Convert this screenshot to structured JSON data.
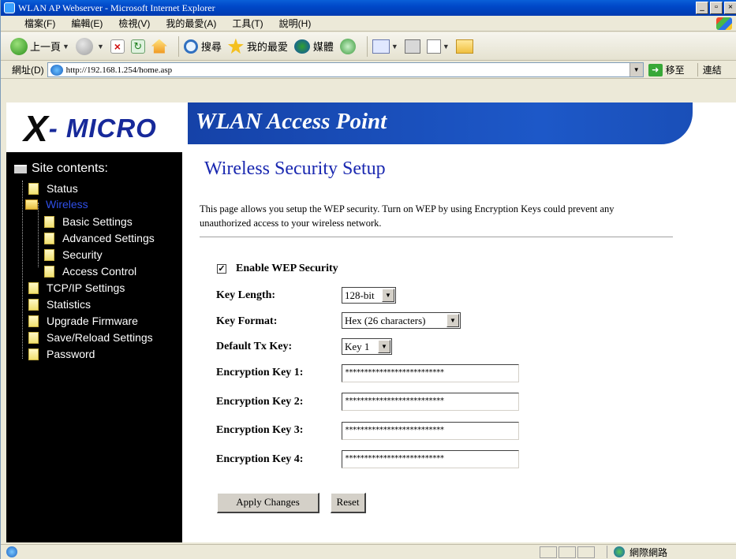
{
  "window": {
    "title": "WLAN AP Webserver - Microsoft Internet Explorer"
  },
  "menubar": {
    "items": [
      "檔案(F)",
      "編輯(E)",
      "檢視(V)",
      "我的最愛(A)",
      "工具(T)",
      "說明(H)"
    ]
  },
  "toolbar": {
    "back": "上一頁",
    "search": "搜尋",
    "favorites": "我的最愛",
    "media": "媒體"
  },
  "addressbar": {
    "label": "網址(D)",
    "url": "http://192.168.1.254/home.asp",
    "go": "移至",
    "links": "連結"
  },
  "banner": {
    "logo_x": "X",
    "logo_rest": "- MICRO",
    "title": "WLAN Access Point"
  },
  "sidebar": {
    "heading": "Site contents:",
    "items": {
      "status": "Status",
      "wireless": "Wireless",
      "basic": "Basic Settings",
      "advanced": "Advanced Settings",
      "security": "Security",
      "access": "Access Control",
      "tcpip": "TCP/IP Settings",
      "statistics": "Statistics",
      "upgrade": "Upgrade Firmware",
      "savereload": "Save/Reload Settings",
      "password": "Password"
    }
  },
  "main": {
    "title": "Wireless Security Setup",
    "description": "This page allows you setup the WEP security. Turn on WEP by using Encryption Keys could prevent any unauthorized access to your wireless network.",
    "enable_wep": {
      "label": "Enable WEP Security",
      "checked": true,
      "mark": "✓"
    },
    "key_length": {
      "label": "Key Length:",
      "value": "128-bit"
    },
    "key_format": {
      "label": "Key Format:",
      "value": "Hex (26 characters)"
    },
    "default_tx_key": {
      "label": "Default Tx Key:",
      "value": "Key 1"
    },
    "key1": {
      "label": "Encryption Key 1:",
      "value": "**************************"
    },
    "key2": {
      "label": "Encryption Key 2:",
      "value": "**************************"
    },
    "key3": {
      "label": "Encryption Key 3:",
      "value": "**************************"
    },
    "key4": {
      "label": "Encryption Key 4:",
      "value": "**************************"
    },
    "apply_label": "Apply Changes",
    "reset_label": "Reset"
  },
  "statusbar": {
    "zone": "網際網路"
  },
  "colors": {
    "title_blue": "#1a28b0",
    "banner_blue": "#1d58c8",
    "active_link": "#2f4fe8"
  }
}
